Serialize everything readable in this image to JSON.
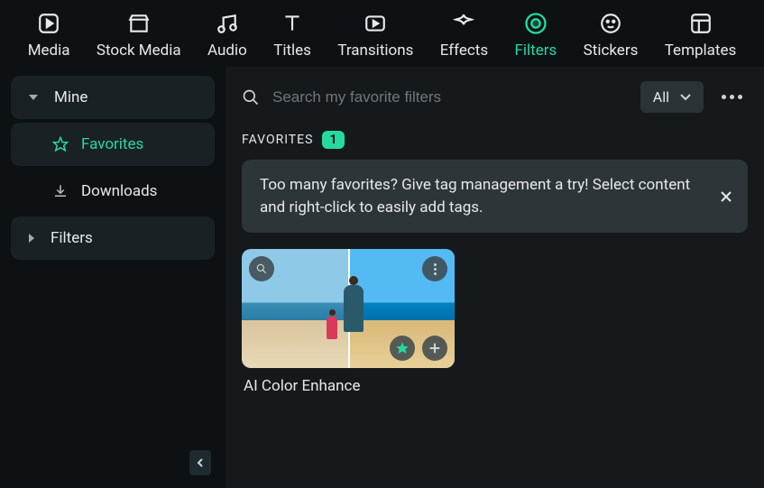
{
  "topnav": [
    {
      "id": "media",
      "label": "Media"
    },
    {
      "id": "stock-media",
      "label": "Stock Media"
    },
    {
      "id": "audio",
      "label": "Audio"
    },
    {
      "id": "titles",
      "label": "Titles"
    },
    {
      "id": "transitions",
      "label": "Transitions"
    },
    {
      "id": "effects",
      "label": "Effects"
    },
    {
      "id": "filters",
      "label": "Filters",
      "active": true
    },
    {
      "id": "stickers",
      "label": "Stickers"
    },
    {
      "id": "templates",
      "label": "Templates"
    }
  ],
  "sidebar": {
    "mine_label": "Mine",
    "favorites_label": "Favorites",
    "downloads_label": "Downloads",
    "filters_label": "Filters"
  },
  "search": {
    "placeholder": "Search my favorite filters"
  },
  "filter_dropdown": {
    "label": "All"
  },
  "section": {
    "title": "FAVORITES",
    "count": "1"
  },
  "tip": {
    "text": "Too many favorites? Give tag management a try! Select content and right-click to easily add tags."
  },
  "card": {
    "title": "AI Color Enhance"
  }
}
